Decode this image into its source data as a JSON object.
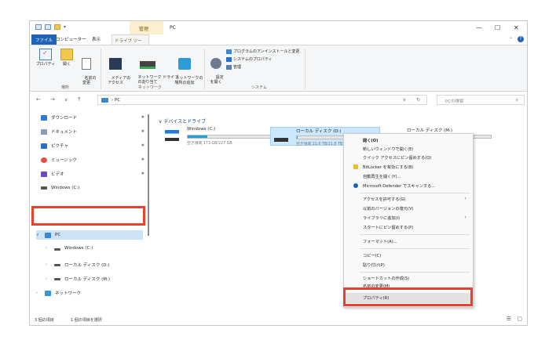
{
  "window": {
    "title": "PC",
    "context_tab": "管理",
    "controls": {
      "minimize": "—",
      "maximize": "☐",
      "close": "✕"
    }
  },
  "ribbon_tabs": [
    "ファイル",
    "コンピューター",
    "表示",
    "ドライブ ツール"
  ],
  "ribbon": {
    "location_group": {
      "label": "場所",
      "buttons": [
        "プロパティ",
        "開く",
        "名前の\n変更"
      ]
    },
    "network_group": {
      "label": "ネットワーク",
      "buttons": [
        "メディアの\nアクセス",
        "ネットワーク ドライブ\nの割り当て",
        "ネットワークの\n場所の追加"
      ]
    },
    "system_group": {
      "label": "システム",
      "settings": "設定\nを開く",
      "items": [
        "プログラムのアンインストールと変更",
        "システムのプロパティ",
        "管理"
      ]
    }
  },
  "address": {
    "crumb": "PC",
    "search_placeholder": "PCの検索"
  },
  "navpane": {
    "quick_access": [
      {
        "label": "ダウンロード",
        "icon": "download-icon",
        "color": "#2f7ad6"
      },
      {
        "label": "ドキュメント",
        "icon": "document-icon",
        "color": "#8a9bb3"
      },
      {
        "label": "ピクチャ",
        "icon": "pictures-icon",
        "color": "#2a6fc9"
      },
      {
        "label": "ミュージック",
        "icon": "music-icon",
        "color": "#e0533b"
      },
      {
        "label": "ビデオ",
        "icon": "video-icon",
        "color": "#6a4bc4"
      },
      {
        "label": "Windows (C:)",
        "icon": "drive-icon",
        "color": "#555555"
      }
    ],
    "pc": {
      "label": "PC"
    },
    "pc_children": [
      "Windows (C:)",
      "ローカル ディスク (D:)",
      "ローカル ディスク (M:)"
    ],
    "network": {
      "label": "ネットワーク"
    }
  },
  "content": {
    "section_title": "デバイスとドライブ",
    "drives": [
      {
        "name": "Windows (C:)",
        "space": "空き領域 173 GB/227 GB",
        "used_fraction": 0.24
      },
      {
        "name": "ローカル ディスク (D:)",
        "space": "空き領域 21.6 TB/21.8 TB",
        "used_fraction": 0.01
      },
      {
        "name": "ローカル ディスク (M:)",
        "space": "",
        "used_fraction": 0.0
      }
    ]
  },
  "context_menu": {
    "items": [
      "開く(O)",
      "新しいウィンドウで開く(E)",
      "クイック アクセスにピン留めする(Q)",
      "BitLocker を有効にする(B)",
      "自動再生を開く(Y)...",
      "Microsoft Defender でスキャンする...",
      "アクセスを許可する(G)",
      "以前のバージョンの復元(V)",
      "ライブラリに追加(I)",
      "スタートにピン留めする(P)",
      "フォーマット(A)...",
      "コピー(C)",
      "貼り付け(P)",
      "ショートカットの作成(S)",
      "名前の変更(M)",
      "プロパティ(R)"
    ]
  },
  "status": {
    "count": "3 個の項目",
    "selected": "1 個の項目を選択"
  },
  "colors": {
    "accent": "#1e63b7",
    "highlight": "#e8412c",
    "selection": "#cce4f7"
  }
}
